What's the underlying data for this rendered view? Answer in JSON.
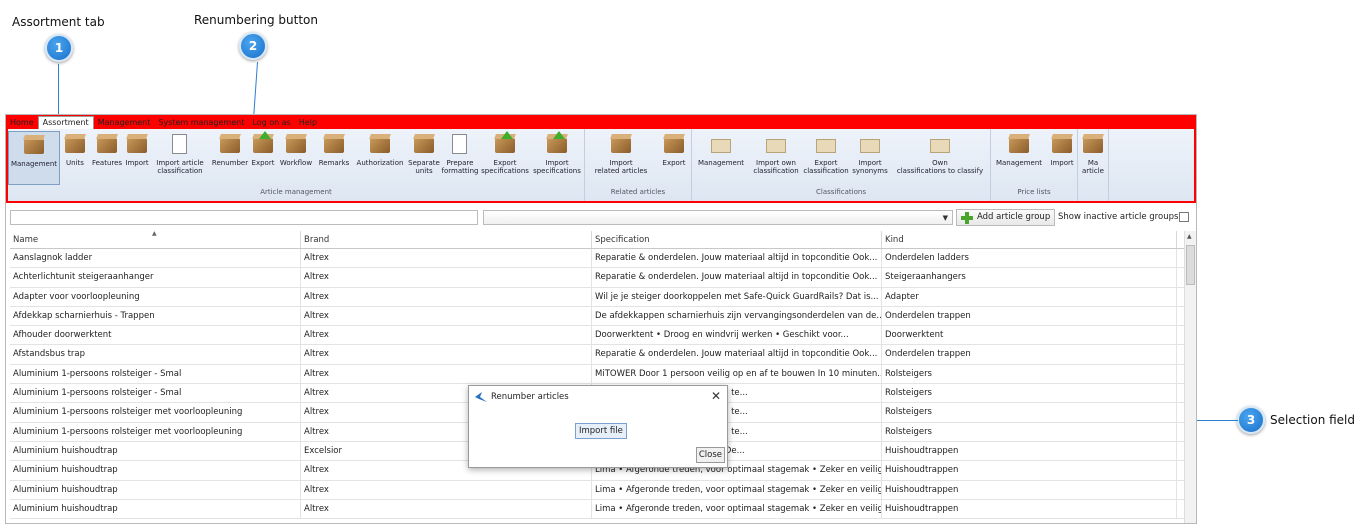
{
  "callouts": [
    {
      "num": "1",
      "label": "Assortment tab"
    },
    {
      "num": "2",
      "label": "Renumbering button"
    },
    {
      "num": "3",
      "label": "Selection field"
    }
  ],
  "menu": [
    "Home",
    "Assortment",
    "Management",
    "System management",
    "Log on as",
    "Help"
  ],
  "ribbon": {
    "groups": [
      {
        "label": "Article management",
        "buttons": [
          "Management",
          "Units",
          "Features",
          "Import",
          "Import article\nclassification",
          "Renumber",
          "Export",
          "Workflow",
          "Remarks",
          "Authorization",
          "Separate\nunits",
          "Prepare\nformatting",
          "Export\nspecifications",
          "Import\nspecifications"
        ]
      },
      {
        "label": "Related articles",
        "buttons": [
          "Import\nrelated articles",
          "Export"
        ]
      },
      {
        "label": "Classifications",
        "buttons": [
          "Management",
          "Import own\nclassification",
          "Export\nclassification",
          "Import\nsynonyms",
          "Own\nclassifications to classify"
        ]
      },
      {
        "label": "Price lists",
        "buttons": [
          "Management",
          "Import"
        ]
      },
      {
        "label": "",
        "buttons": [
          "Ma\narticle"
        ]
      }
    ]
  },
  "toolbar": {
    "add_label": "Add article group",
    "show_inactive": "Show inactive article groups"
  },
  "grid": {
    "headers": [
      "Name",
      "Brand",
      "Specification",
      "Kind"
    ],
    "rows": [
      [
        "Aanslagnok ladder",
        "Altrex",
        "Reparatie & onderdelen. Jouw materiaal altijd in topconditie    Ook...",
        "Onderdelen ladders"
      ],
      [
        "Achterlichtunit steigeraanhanger",
        "Altrex",
        "Reparatie & onderdelen. Jouw materiaal altijd in topconditie    Ook...",
        "Steigeraanhangers"
      ],
      [
        "Adapter voor voorloopleuning",
        "Altrex",
        "Wil je je steiger doorkoppelen met Safe-Quick GuardRails? Dat is...",
        "Adapter"
      ],
      [
        "Afdekkap scharnierhuis - Trappen",
        "Altrex",
        "De afdekkappen scharnierhuis zijn vervangingsonderdelen van de...",
        "Onderdelen trappen"
      ],
      [
        "Afhouder doorwerktent",
        "Altrex",
        "Doorwerktent • Droog en windvrij werken • Geschikt voor...",
        "Doorwerktent"
      ],
      [
        "Afstandsbus trap",
        "Altrex",
        "Reparatie & onderdelen. Jouw materiaal altijd in topconditie    Ook...",
        "Onderdelen trappen"
      ],
      [
        "Aluminium 1-persoons rolsteiger - Smal",
        "Altrex",
        "MiTOWER Door 1 persoon veilig op en af te bouwen In 10 minuten...",
        "Rolsteigers"
      ],
      [
        "Aluminium 1-persoons rolsteiger - Smal",
        "Altrex",
        "                                  op te bouwen, door 2 personen te...",
        "Rolsteigers"
      ],
      [
        "Aluminium 1-persoons rolsteiger met voorloopleuning",
        "Altrex",
        "                                  op te bouwen, door 2 personen te...",
        "Rolsteigers"
      ],
      [
        "Aluminium 1-persoons rolsteiger met voorloopleuning",
        "Altrex",
        "                                  op te bouwen, door 2 personen te...",
        "Rolsteigers"
      ],
      [
        "Aluminium huishoudtrap",
        "Excelsior",
        "                                  chikt voor huishoudelijk werk. De...",
        "Huishoudtrappen"
      ],
      [
        "Aluminium huishoudtrap",
        "Altrex",
        "Lima • Afgeronde treden, voor optimaal stagemak • Zeker en veilig...",
        "Huishoudtrappen"
      ],
      [
        "Aluminium huishoudtrap",
        "Altrex",
        "Lima • Afgeronde treden, voor optimaal stagemak • Zeker en veilig...",
        "Huishoudtrappen"
      ],
      [
        "Aluminium huishoudtrap",
        "Altrex",
        "Lima • Afgeronde treden, voor optimaal stagemak • Zeker en veilig...",
        "Huishoudtrappen"
      ]
    ]
  },
  "dialog": {
    "title": "Renumber articles",
    "import_label": "Import file",
    "close_label": "Close"
  }
}
